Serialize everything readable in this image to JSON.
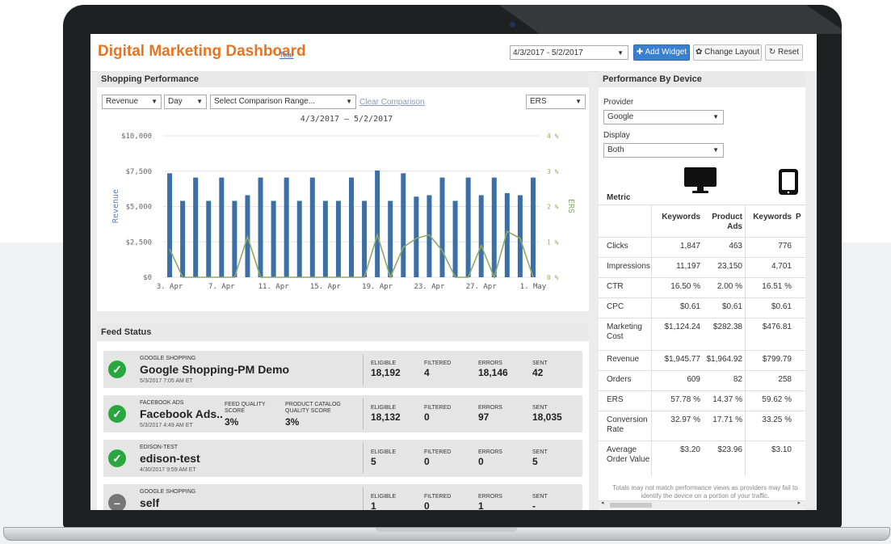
{
  "app": {
    "title": "Digital Marketing Dashboard",
    "tour_link": "Tour",
    "date_range": "4/3/2017 - 5/2/2017",
    "buttons": {
      "add_widget": "Add Widget",
      "change_layout": "Change Layout",
      "reset": "Reset"
    },
    "icons": {
      "add": "plus-icon",
      "layout": "gear-icon",
      "reset": "refresh-icon",
      "caret": "caret-down-icon"
    }
  },
  "shopping": {
    "title": "Shopping Performance",
    "metric_select": "Revenue",
    "interval_select": "Day",
    "comparison_select": "Select Comparison Range...",
    "clear_comparison": "Clear Comparison",
    "right_metric_select": "ERS"
  },
  "chart_data": {
    "type": "bar",
    "title": "4/3/2017 – 5/2/2017",
    "ylabel": "Revenue",
    "y2label": "ERS",
    "ylim": [
      0,
      10000
    ],
    "y2lim": [
      0,
      4
    ],
    "y_ticks": [
      "$0",
      "$2,500",
      "$5,000",
      "$7,500",
      "$10,000"
    ],
    "y2_ticks": [
      "0 %",
      "1 %",
      "2 %",
      "3 %",
      "4 %"
    ],
    "x_ticks": [
      "3. Apr",
      "7. Apr",
      "11. Apr",
      "15. Apr",
      "19. Apr",
      "23. Apr",
      "27. Apr",
      "1. May"
    ],
    "grid": true,
    "series": [
      {
        "name": "Revenue",
        "kind": "bar",
        "color": "#3c6ea8",
        "values": [
          7350,
          5400,
          7050,
          5400,
          7050,
          5400,
          5800,
          7050,
          5400,
          7050,
          5400,
          7050,
          5400,
          5400,
          7050,
          5400,
          7550,
          5400,
          7350,
          5700,
          5800,
          7050,
          5400,
          7050,
          5800,
          7050,
          5950,
          5800,
          7050
        ]
      },
      {
        "name": "ERS",
        "kind": "line",
        "color": "#8cac62",
        "values": [
          0.8,
          0.0,
          0.0,
          0.0,
          0.0,
          0.0,
          1.15,
          0.0,
          0.0,
          0.0,
          0.0,
          0.0,
          0.0,
          0.0,
          0.0,
          0.0,
          1.2,
          0.0,
          0.85,
          1.1,
          1.2,
          0.75,
          0.0,
          0.0,
          0.9,
          0.0,
          1.3,
          1.1,
          0.0
        ]
      }
    ]
  },
  "feed": {
    "title": "Feed Status",
    "labels": {
      "eligible": "ELIGIBLE",
      "filtered": "FILTERED",
      "errors": "ERRORS",
      "sent": "SENT",
      "fqs": "FEED QUALITY\nSCORE",
      "pcqs": "PRODUCT CATALOG\nQUALITY SCORE"
    },
    "rows": [
      {
        "provider": "GOOGLE SHOPPING",
        "name": "Google Shopping-PM Demo",
        "date": "5/3/2017 7:05 AM ET",
        "eligible": "18,192",
        "filtered": "4",
        "errors": "18,146",
        "sent": "42",
        "status": "ok"
      },
      {
        "provider": "FACEBOOK ADS",
        "name": "Facebook Ads..",
        "date": "5/3/2017 4:49 AM ET",
        "fqs": "3%",
        "pcqs": "3%",
        "eligible": "18,132",
        "filtered": "0",
        "errors": "97",
        "sent": "18,035",
        "status": "ok"
      },
      {
        "provider": "EDISON-TEST",
        "name": "edison-test",
        "date": "4/30/2017 9:59 AM ET",
        "eligible": "5",
        "filtered": "0",
        "errors": "0",
        "sent": "5",
        "status": "ok"
      },
      {
        "provider": "GOOGLE SHOPPING",
        "name": "self",
        "date": "",
        "eligible": "1",
        "filtered": "0",
        "errors": "1",
        "sent": "-",
        "status": "paused"
      }
    ]
  },
  "device": {
    "title": "Performance By Device",
    "provider_label": "Provider",
    "provider_value": "Google",
    "display_label": "Display",
    "display_value": "Both",
    "metric_label": "Metric",
    "icons": [
      "desktop-icon",
      "tablet-icon"
    ],
    "columns": [
      "Keywords",
      "Product Ads",
      "Keywords",
      "P"
    ],
    "rows": [
      {
        "metric": "Clicks",
        "values": [
          "1,847",
          "463",
          "776"
        ]
      },
      {
        "metric": "Impressions",
        "values": [
          "11,197",
          "23,150",
          "4,701"
        ]
      },
      {
        "metric": "CTR",
        "values": [
          "16.50 %",
          "2.00 %",
          "16.51 %"
        ]
      },
      {
        "metric": "CPC",
        "values": [
          "$0.61",
          "$0.61",
          "$0.61"
        ]
      },
      {
        "metric": "Marketing Cost",
        "values": [
          "$1,124.24",
          "$282.38",
          "$476.81"
        ]
      },
      {
        "metric": "Revenue",
        "values": [
          "$1,945.77",
          "$1,964.92",
          "$799.79"
        ]
      },
      {
        "metric": "Orders",
        "values": [
          "609",
          "82",
          "258"
        ]
      },
      {
        "metric": "ERS",
        "values": [
          "57.78 %",
          "14.37 %",
          "59.62 %"
        ]
      },
      {
        "metric": "Conversion Rate",
        "values": [
          "32.97 %",
          "17.71 %",
          "33.25 %"
        ]
      },
      {
        "metric": "Average Order Value",
        "values": [
          "$3.20",
          "$23.96",
          "$3.10"
        ]
      }
    ],
    "footnote": "Totals may not match performance views as providers may fail to identify the device on a portion of your traffic."
  }
}
